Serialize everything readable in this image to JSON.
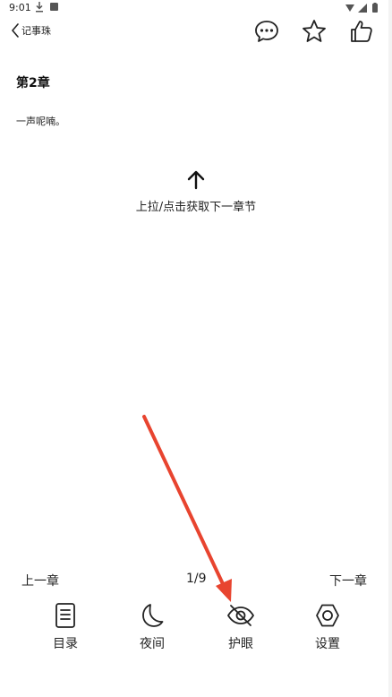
{
  "status_bar": {
    "time": "9:01"
  },
  "header": {
    "back_label": "记事珠",
    "icons": {
      "comment": "comment-icon",
      "favorite": "star-icon",
      "like": "thumbs-up-icon"
    }
  },
  "content": {
    "chapter_title": "第2章",
    "chapter_text": "一声呢喃。",
    "pull_hint": "上拉/点击获取下一章节"
  },
  "page_nav": {
    "prev": "上一章",
    "page": "1/9",
    "next": "下一章"
  },
  "toolbar": {
    "items": [
      {
        "label": "目录",
        "icon": "toc-icon"
      },
      {
        "label": "夜间",
        "icon": "moon-icon"
      },
      {
        "label": "护眼",
        "icon": "eye-off-icon"
      },
      {
        "label": "设置",
        "icon": "hexagon-settings-icon"
      }
    ]
  },
  "annotation": {
    "arrow_color": "#e8442f",
    "target": "护眼"
  }
}
